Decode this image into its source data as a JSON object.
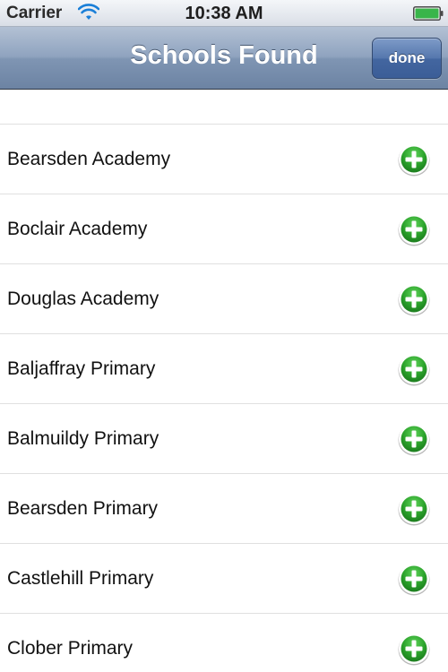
{
  "status_bar": {
    "carrier": "Carrier",
    "time": "10:38 AM",
    "wifi_icon": "wifi-icon",
    "battery_icon": "battery-icon",
    "battery_level": 1.0
  },
  "nav": {
    "title": "Schools Found",
    "done_label": "done"
  },
  "schools": [
    {
      "name": "Bearsden Academy"
    },
    {
      "name": "Boclair Academy"
    },
    {
      "name": "Douglas Academy"
    },
    {
      "name": "Baljaffray Primary"
    },
    {
      "name": "Balmuildy Primary"
    },
    {
      "name": "Bearsden Primary"
    },
    {
      "name": "Castlehill Primary"
    },
    {
      "name": "Clober Primary"
    }
  ],
  "colors": {
    "add_button_green": "#2aa12a",
    "nav_bar_blue": "#8fa3bf",
    "done_button_blue": "#4a6aa3"
  }
}
